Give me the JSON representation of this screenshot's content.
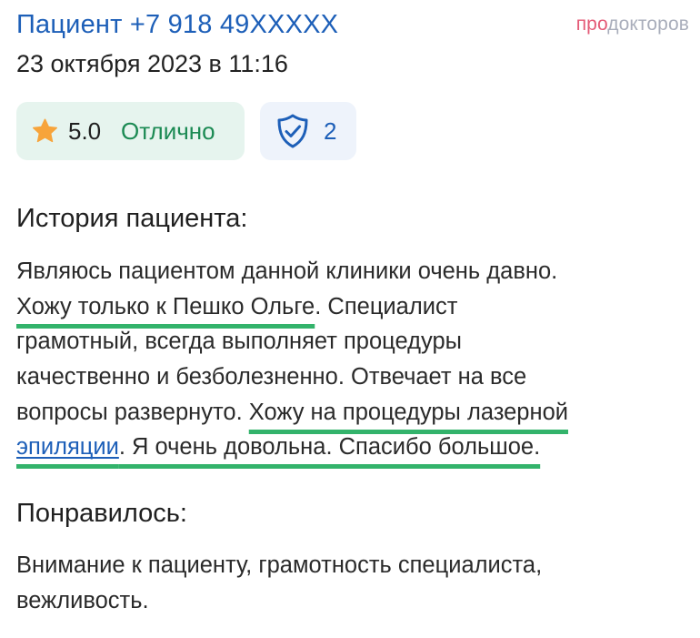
{
  "header": {
    "patient_name": "Пациент +7 918 49XXXXX",
    "date": "23 октября 2023 в 11:16",
    "logo_part_1": "про",
    "logo_part_2": "докторов"
  },
  "badges": {
    "rating_value": "5.0",
    "rating_text": "Отлично",
    "rating_icon": "star-icon",
    "verified_count": "2",
    "verified_icon": "shield-check-icon"
  },
  "colors": {
    "accent_blue": "#1d5fb8",
    "rating_green": "#1b8a53",
    "highlight_green": "#33b36b",
    "star_orange": "#f7a43b",
    "logo_pink": "#e45b77",
    "logo_gray": "#a9aebb"
  },
  "history": {
    "title": "История пациента:",
    "line_1": "Являюсь пациентом данной клиники очень давно.",
    "line_2_highlight": "Хожу только к Пешко Ольге",
    "line_2_rest": ". Специалист",
    "line_3": "грамотный, всегда выполняет процедуры",
    "line_4": "качественно и безболезненно. Отвечает на все",
    "line_5_start": "вопросы развернуто. ",
    "line_5_highlight": "Хожу на процедуры лазерной",
    "line_6_link": "эпиляции",
    "line_6_highlight_rest": ". Я очень довольна. Спасибо большое."
  },
  "liked": {
    "title": "Понравилось:",
    "line_1": "Внимание к пациенту, грамотность специалиста,",
    "line_2": "вежливость."
  }
}
